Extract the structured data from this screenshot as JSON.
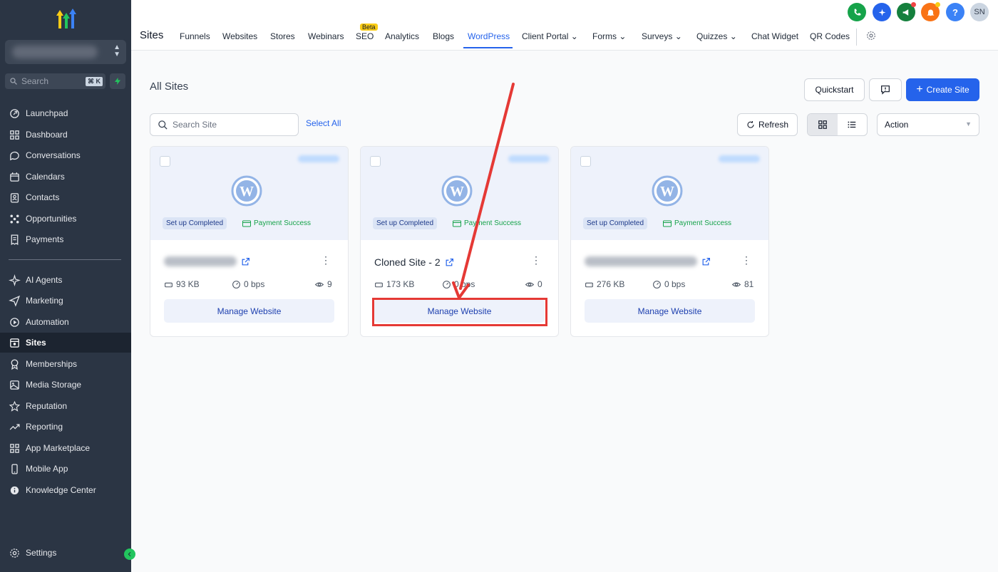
{
  "sidebar": {
    "search_placeholder": "Search",
    "search_shortcut": "⌘ K",
    "items": [
      {
        "label": "Launchpad",
        "icon": "rocket-icon"
      },
      {
        "label": "Dashboard",
        "icon": "grid-icon"
      },
      {
        "label": "Conversations",
        "icon": "chat-icon"
      },
      {
        "label": "Calendars",
        "icon": "calendar-icon"
      },
      {
        "label": "Contacts",
        "icon": "contacts-icon"
      },
      {
        "label": "Opportunities",
        "icon": "opportunities-icon"
      },
      {
        "label": "Payments",
        "icon": "payments-icon"
      },
      {
        "label": "AI Agents",
        "icon": "sparkle-icon"
      },
      {
        "label": "Marketing",
        "icon": "send-icon"
      },
      {
        "label": "Automation",
        "icon": "automation-icon"
      },
      {
        "label": "Sites",
        "icon": "sites-icon",
        "active": true
      },
      {
        "label": "Memberships",
        "icon": "award-icon"
      },
      {
        "label": "Media Storage",
        "icon": "image-icon"
      },
      {
        "label": "Reputation",
        "icon": "star-icon"
      },
      {
        "label": "Reporting",
        "icon": "trend-icon"
      },
      {
        "label": "App Marketplace",
        "icon": "apps-icon"
      },
      {
        "label": "Mobile App",
        "icon": "phone-icon"
      },
      {
        "label": "Knowledge Center",
        "icon": "info-icon"
      }
    ],
    "settings_label": "Settings"
  },
  "topnav": {
    "title": "Sites",
    "tabs": [
      "Funnels",
      "Websites",
      "Stores",
      "Webinars",
      "SEO",
      "Analytics",
      "Blogs",
      "WordPress",
      "Client Portal",
      "Forms",
      "Surveys",
      "Quizzes",
      "Chat Widget",
      "QR Codes"
    ],
    "active_tab": "WordPress",
    "beta_label": "Beta",
    "avatar_initials": "SN"
  },
  "page": {
    "title": "All Sites",
    "quickstart_label": "Quickstart",
    "create_label": "Create Site",
    "search_placeholder": "Search Site",
    "select_all_label": "Select All",
    "refresh_label": "Refresh",
    "action_label": "Action"
  },
  "cards": [
    {
      "name": "",
      "size": "93 KB",
      "bandwidth": "0 bps",
      "views": "9",
      "status": "Set up Completed",
      "payment": "Payment Success",
      "button": "Manage Website"
    },
    {
      "name": "Cloned Site - 2",
      "size": "173 KB",
      "bandwidth": "0 bps",
      "views": "0",
      "status": "Set up Completed",
      "payment": "Payment Success",
      "button": "Manage Website"
    },
    {
      "name": "",
      "size": "276 KB",
      "bandwidth": "0 bps",
      "views": "81",
      "status": "Set up Completed",
      "payment": "Payment Success",
      "button": "Manage Website"
    }
  ],
  "colors": {
    "sidebar_bg": "#2b3544",
    "accent": "#2563eb",
    "success": "#16a34a",
    "annotation": "#e53935"
  }
}
